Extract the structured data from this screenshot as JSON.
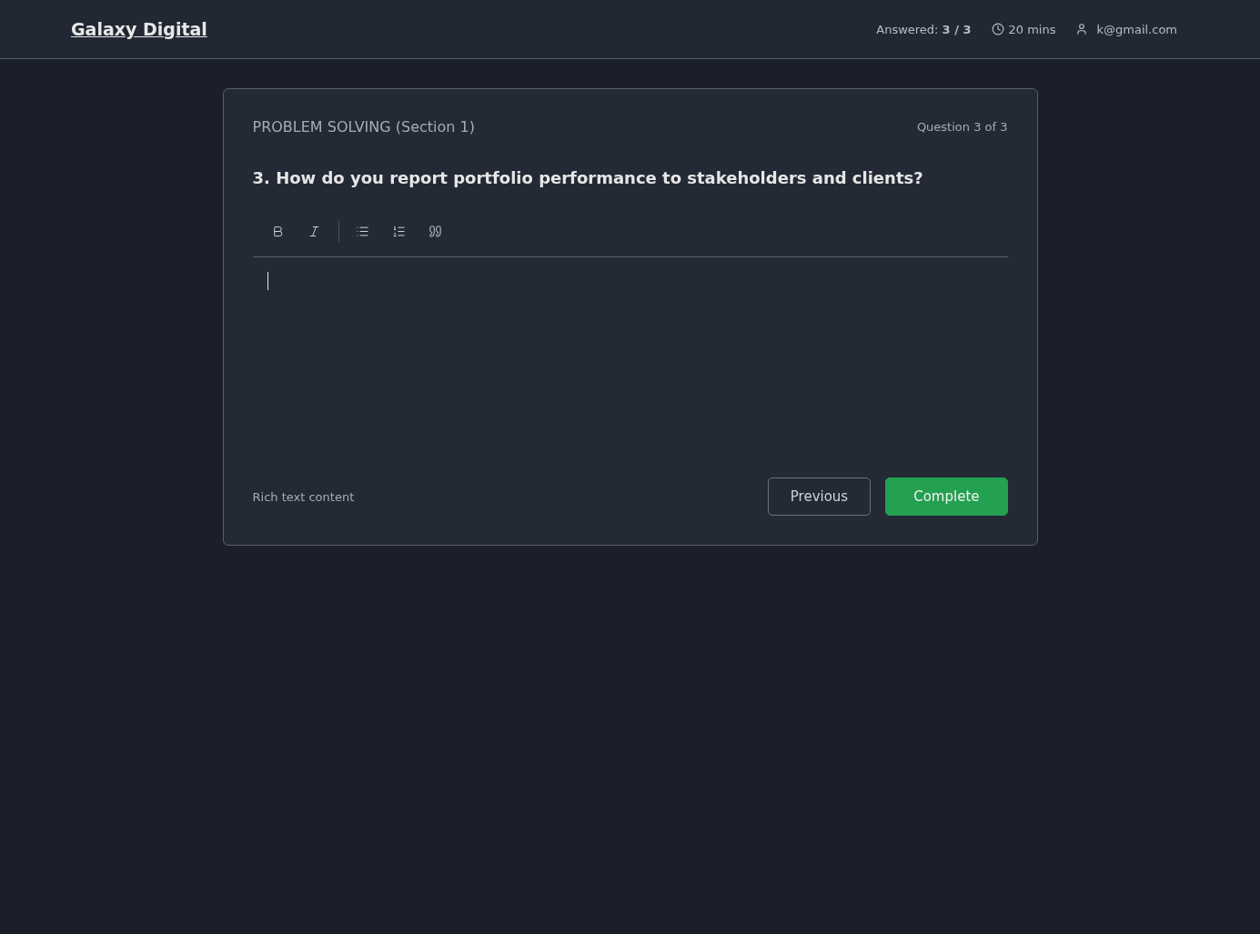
{
  "header": {
    "brand": "Galaxy Digital",
    "answered": "Answered: **3 / 3**",
    "time": "20 mins",
    "user": "k@gmail.com"
  },
  "card": {
    "section": "PROBLEM SOLVING (Section 1)",
    "counter": "Question 3 of 3",
    "question": "3. How do you report portfolio performance to stakeholders and clients?",
    "toolbar_groups": [
      [
        {
          "kind": "bold"
        },
        {
          "kind": "italic"
        }
      ],
      [
        {
          "kind": "bullet-list"
        },
        {
          "kind": "numbered-list"
        },
        {
          "kind": "quote"
        }
      ]
    ],
    "editor": {
      "focused": true
    },
    "hint": "Rich text content",
    "buttons": [
      {
        "label": "Previous",
        "kind": "secondary"
      },
      {
        "label": "Complete",
        "kind": "primary"
      }
    ]
  }
}
